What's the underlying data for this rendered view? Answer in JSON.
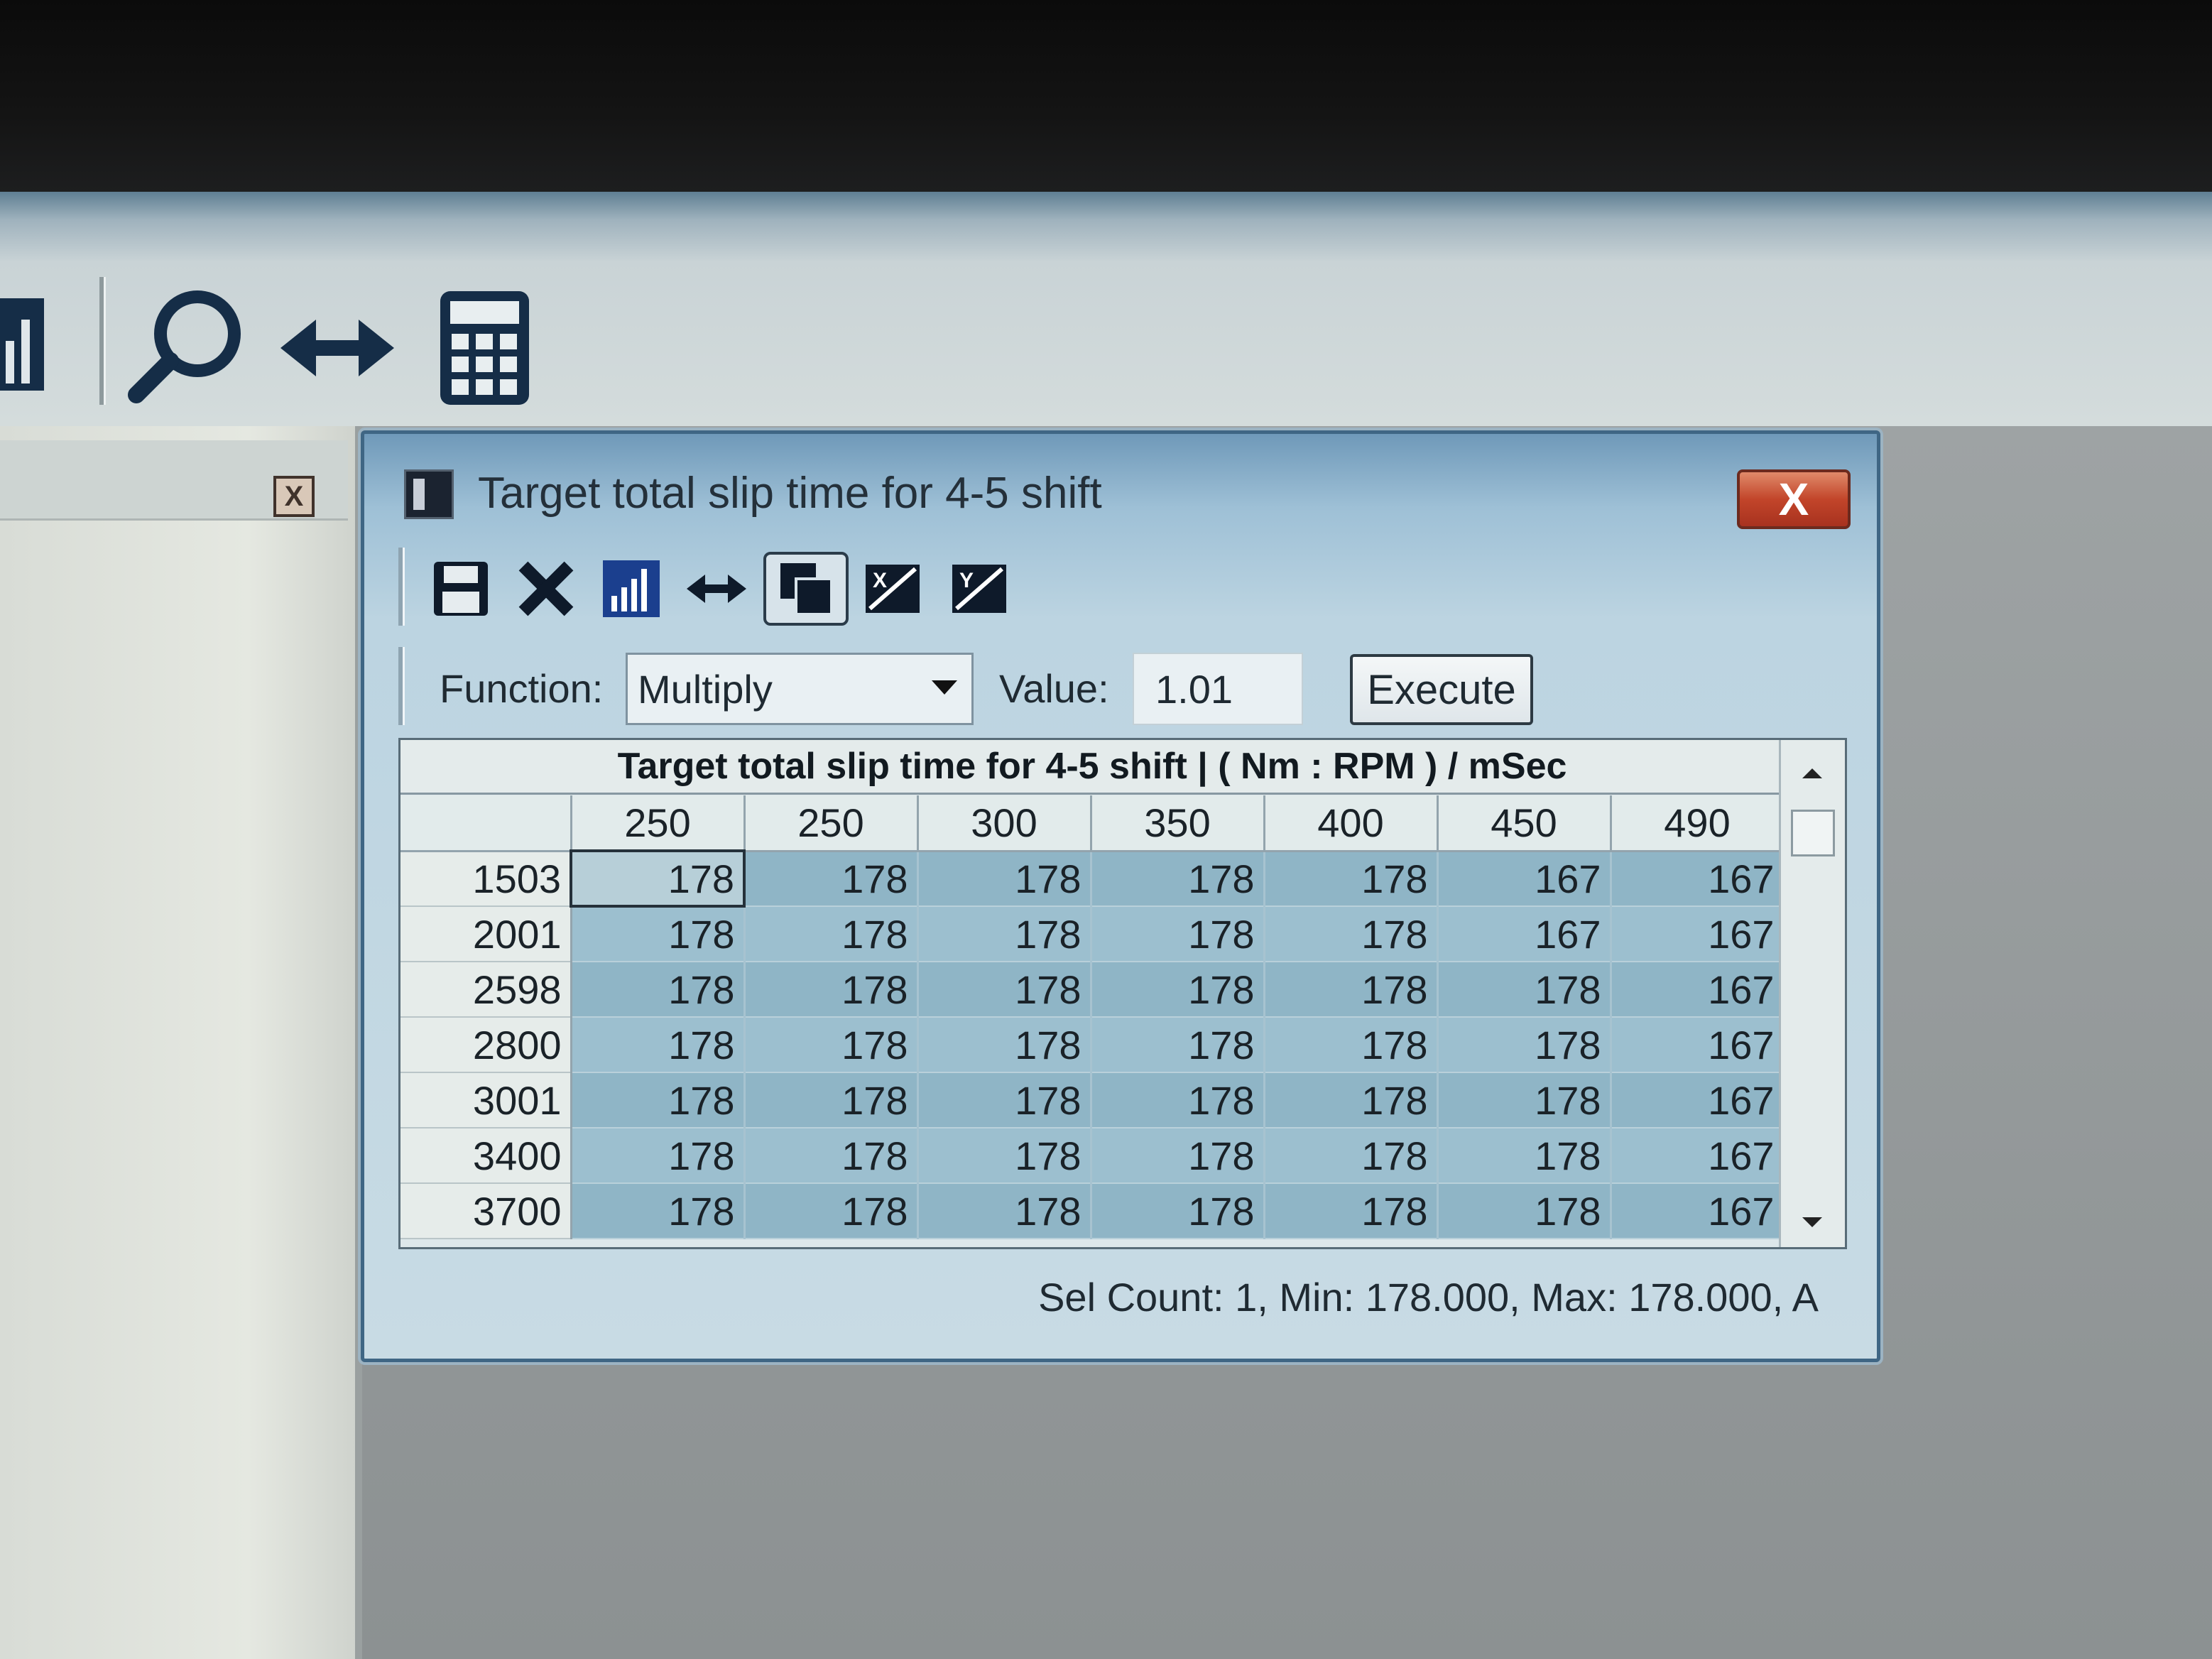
{
  "dialog": {
    "title": "Target total slip time for 4-5 shift",
    "close_label": "X"
  },
  "left_panel": {
    "close_label": "X"
  },
  "function_bar": {
    "function_label": "Function:",
    "function_selected": "Multiply",
    "value_label": "Value:",
    "value": "1.01",
    "execute_label": "Execute"
  },
  "grid": {
    "title": "Target total slip time for 4-5 shift |  ( Nm : RPM ) / mSec",
    "columns": [
      "250",
      "250",
      "300",
      "350",
      "400",
      "450",
      "490"
    ],
    "rows": [
      {
        "label": "1503",
        "values": [
          "178",
          "178",
          "178",
          "178",
          "178",
          "167",
          "167"
        ]
      },
      {
        "label": "2001",
        "values": [
          "178",
          "178",
          "178",
          "178",
          "178",
          "167",
          "167"
        ]
      },
      {
        "label": "2598",
        "values": [
          "178",
          "178",
          "178",
          "178",
          "178",
          "178",
          "167"
        ]
      },
      {
        "label": "2800",
        "values": [
          "178",
          "178",
          "178",
          "178",
          "178",
          "178",
          "167"
        ]
      },
      {
        "label": "3001",
        "values": [
          "178",
          "178",
          "178",
          "178",
          "178",
          "178",
          "167"
        ]
      },
      {
        "label": "3400",
        "values": [
          "178",
          "178",
          "178",
          "178",
          "178",
          "178",
          "167"
        ]
      },
      {
        "label": "3700",
        "values": [
          "178",
          "178",
          "178",
          "178",
          "178",
          "178",
          "167"
        ]
      }
    ],
    "selected": {
      "row": 0,
      "col": 0
    }
  },
  "status_text": "Sel Count: 1, Min: 178.000, Max: 178.000, A",
  "icons": {
    "main_toolbar": [
      "chart-icon",
      "search-icon",
      "swap-icon",
      "calculator-icon"
    ],
    "dialog_toolbar": [
      "save-icon",
      "delete-icon",
      "chart-icon",
      "swap-icon",
      "copy-icon",
      "x-axis-icon",
      "y-axis-icon"
    ]
  },
  "colors": {
    "cell_bg": "#9cbfcf",
    "dialog_close": "#c2452a",
    "title_bar": "#9ec0d6"
  }
}
